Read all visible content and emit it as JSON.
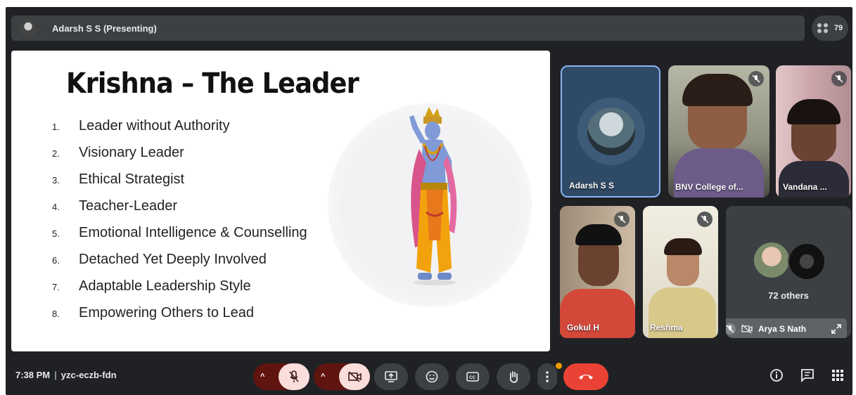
{
  "meeting": {
    "presenter_label": "Adarsh S S (Presenting)",
    "participant_count": "79",
    "time": "7:38 PM",
    "separator": "|",
    "code": "yzc-eczb-fdn"
  },
  "slide": {
    "title": "Krishna – The Leader",
    "items": [
      {
        "num": "1.",
        "text": "Leader without Authority"
      },
      {
        "num": "2.",
        "text": "Visionary Leader"
      },
      {
        "num": "3.",
        "text": "Ethical Strategist"
      },
      {
        "num": "4.",
        "text": "Teacher-Leader"
      },
      {
        "num": "5.",
        "text": "Emotional Intelligence & Counselling"
      },
      {
        "num": "6.",
        "text": "Detached Yet Deeply Involved"
      },
      {
        "num": "7.",
        "text": "Adaptable Leadership Style"
      },
      {
        "num": "8.",
        "text": "Empowering Others to Lead"
      }
    ]
  },
  "tiles": {
    "adarsh": "Adarsh S S",
    "bnv": "BNV College of...",
    "vandana": "Vandana ...",
    "gokul": "Gokul H",
    "reshma": "Reshma",
    "others": "72 others",
    "arya": "Arya S Nath"
  },
  "colors": {
    "background": "#202124",
    "control": "#3c4043",
    "end_call": "#ea4335",
    "active_speaker": "#8ab4f8"
  }
}
